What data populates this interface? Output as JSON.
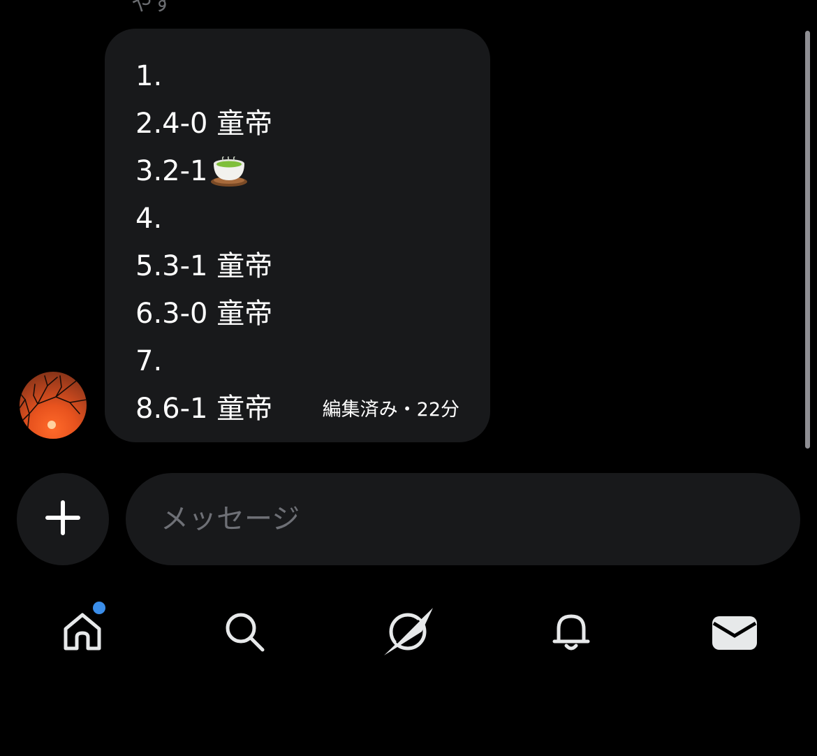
{
  "chat": {
    "sender_name": "やす",
    "message": {
      "lines": [
        "1.",
        "2.4-0 童帝",
        "3.2-1",
        "4.",
        "5.3-1 童帝",
        "6.3-0 童帝",
        "7.",
        "8.6-1 童帝"
      ],
      "meta": "編集済み・22分"
    }
  },
  "composer": {
    "placeholder": "メッセージ"
  },
  "nav": {
    "items": [
      "home-icon",
      "search-icon",
      "explore-icon",
      "bell-icon",
      "mail-icon"
    ],
    "notification_color": "#3b8eea"
  },
  "colors": {
    "background": "#000000",
    "bubble": "#18191b",
    "placeholder": "#6e7076",
    "icon": "#e7e9ea"
  }
}
